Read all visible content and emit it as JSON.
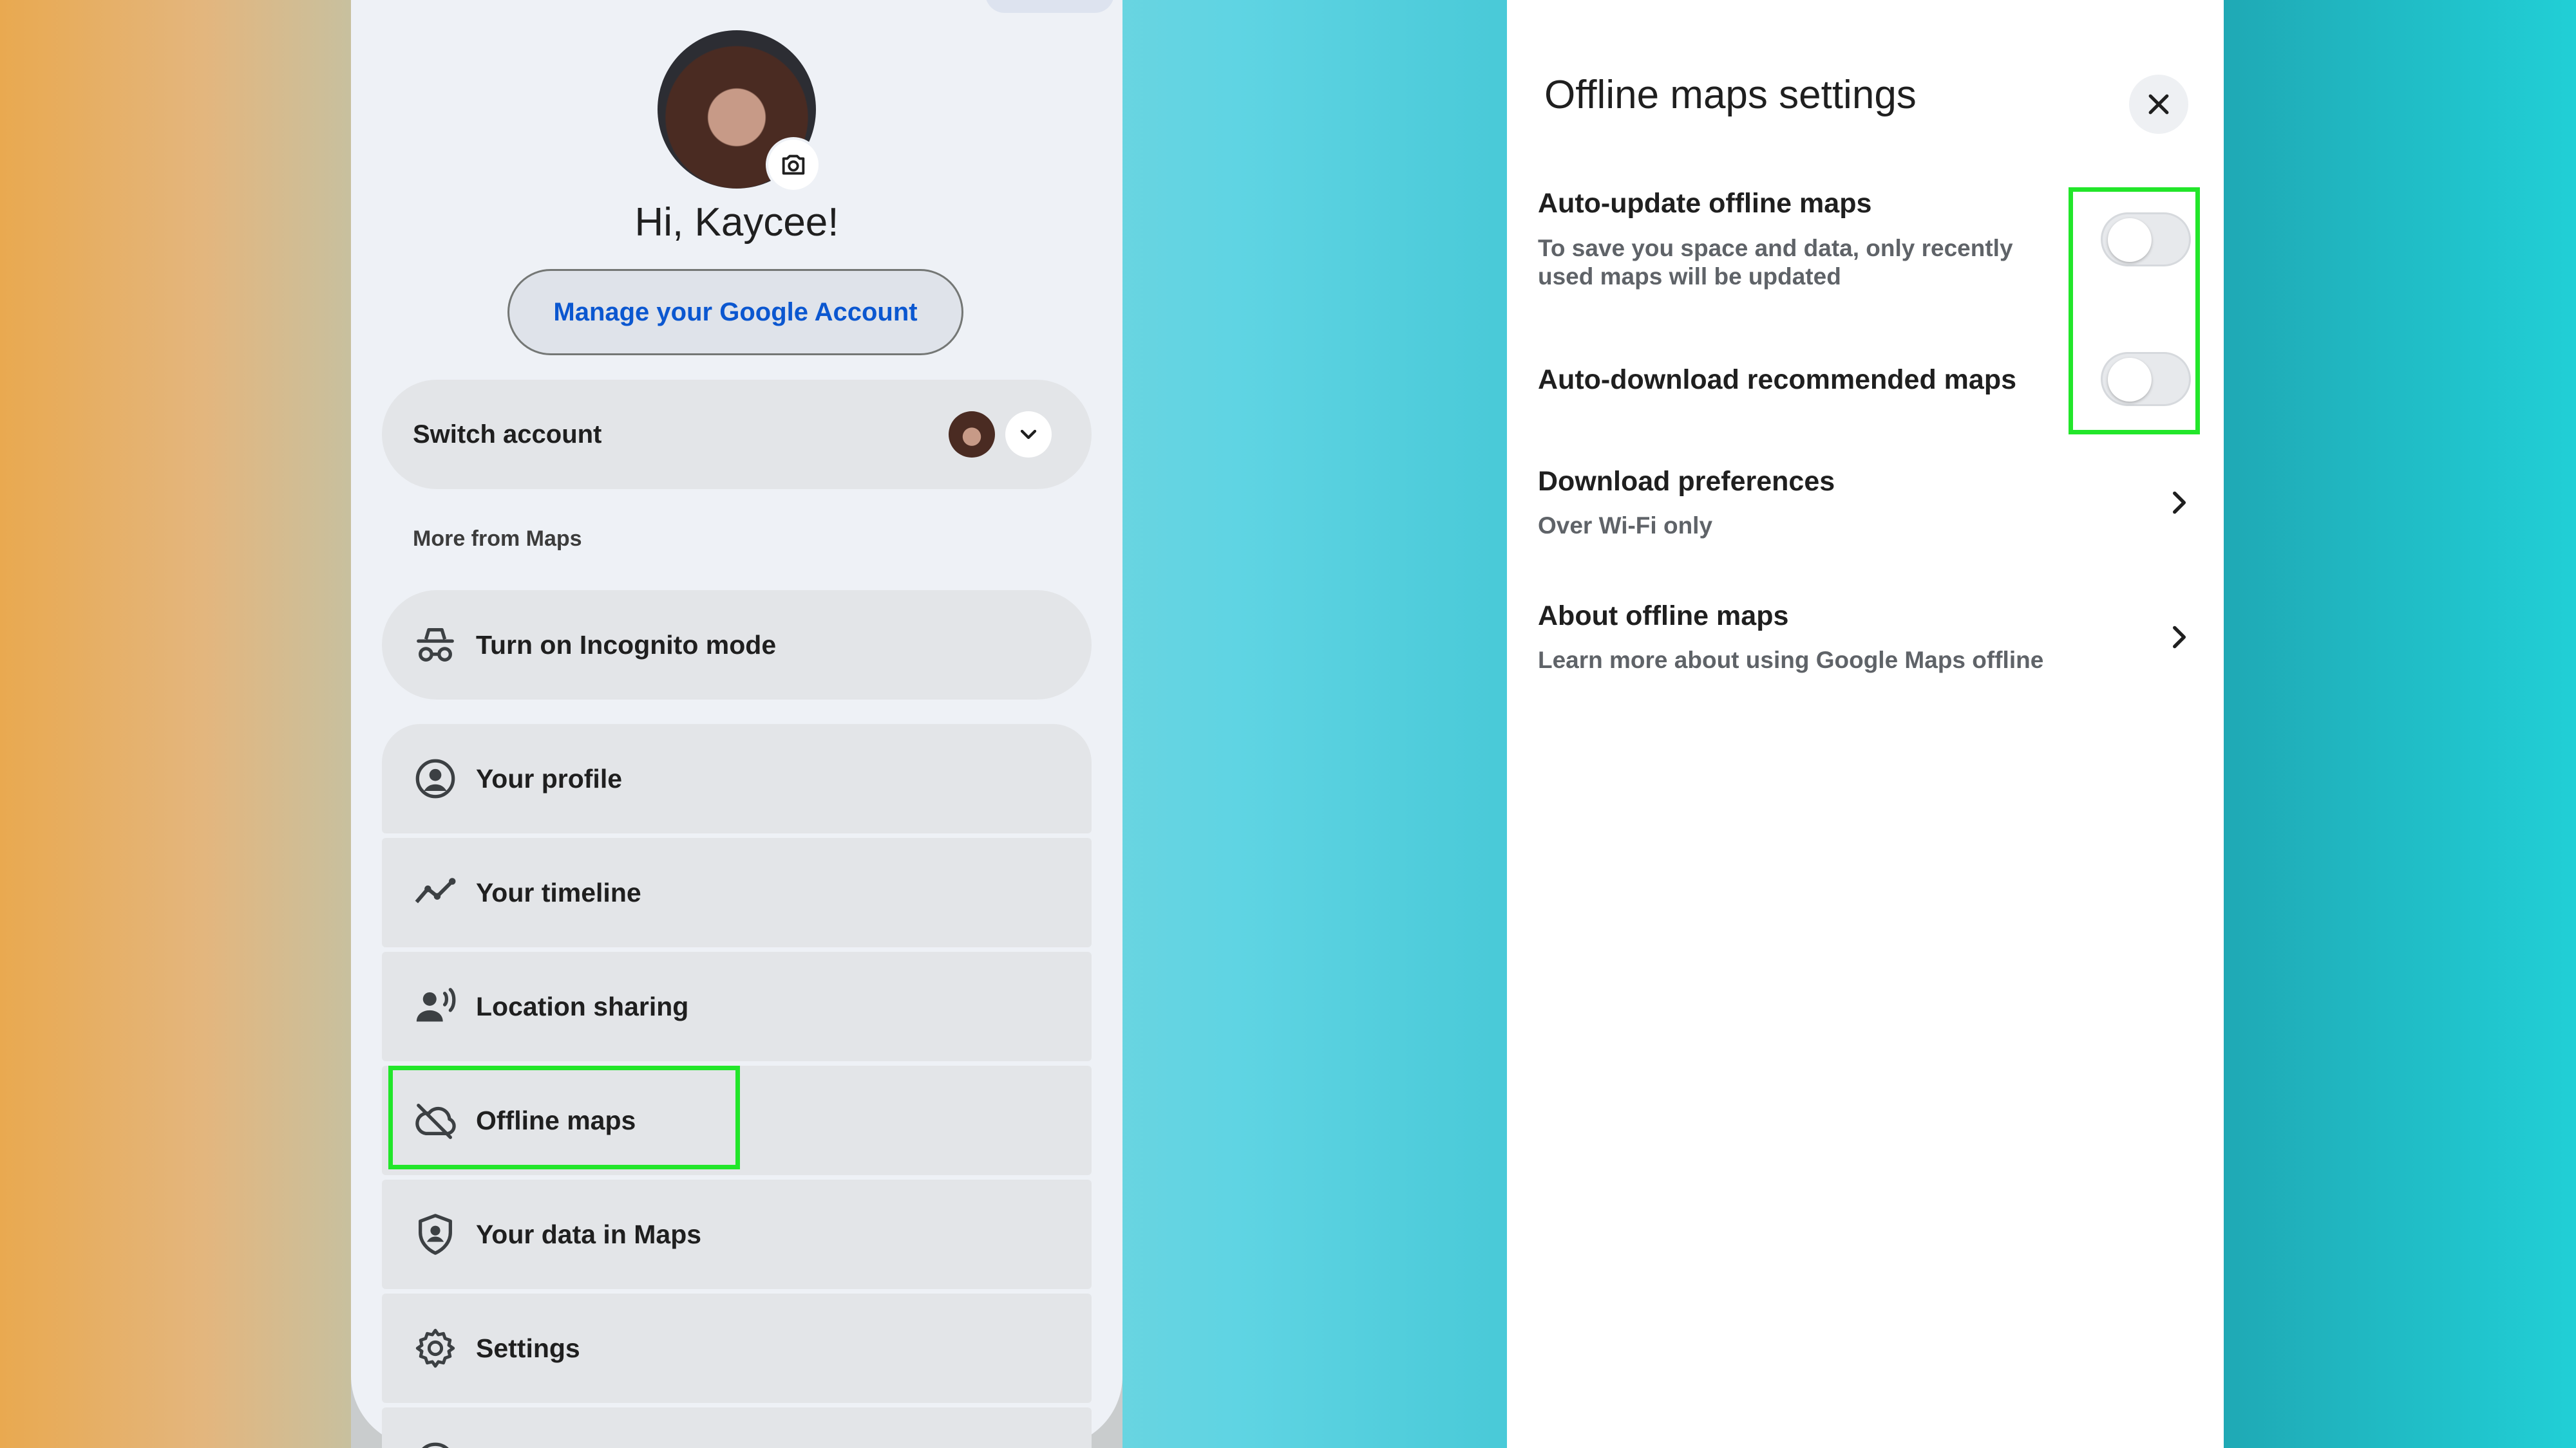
{
  "left_panel": {
    "greeting": "Hi, Kaycee!",
    "manage_account": "Manage your Google Account",
    "switch_account": "Switch account",
    "section_label": "More from Maps",
    "incognito": "Turn on Incognito mode",
    "menu": [
      {
        "label": "Your profile",
        "icon": "profile-icon"
      },
      {
        "label": "Your timeline",
        "icon": "timeline-icon"
      },
      {
        "label": "Location sharing",
        "icon": "location-sharing-icon"
      },
      {
        "label": "Offline maps",
        "icon": "cloud-off-icon"
      },
      {
        "label": "Your data in Maps",
        "icon": "shield-person-icon"
      },
      {
        "label": "Settings",
        "icon": "gear-icon"
      }
    ]
  },
  "settings_panel": {
    "title": "Offline maps settings",
    "auto_update": {
      "title": "Auto-update offline maps",
      "subtitle_line1": "To save you space and data, only recently",
      "subtitle_line2": "used maps will be updated",
      "enabled": false
    },
    "auto_download": {
      "title": "Auto-download recommended maps",
      "enabled": false
    },
    "download_prefs": {
      "title": "Download preferences",
      "subtitle": "Over Wi-Fi only"
    },
    "about": {
      "title": "About offline maps",
      "subtitle": "Learn more about using Google Maps offline"
    }
  },
  "colors": {
    "highlight": "#22e62a",
    "link_blue": "#0b57d0"
  }
}
